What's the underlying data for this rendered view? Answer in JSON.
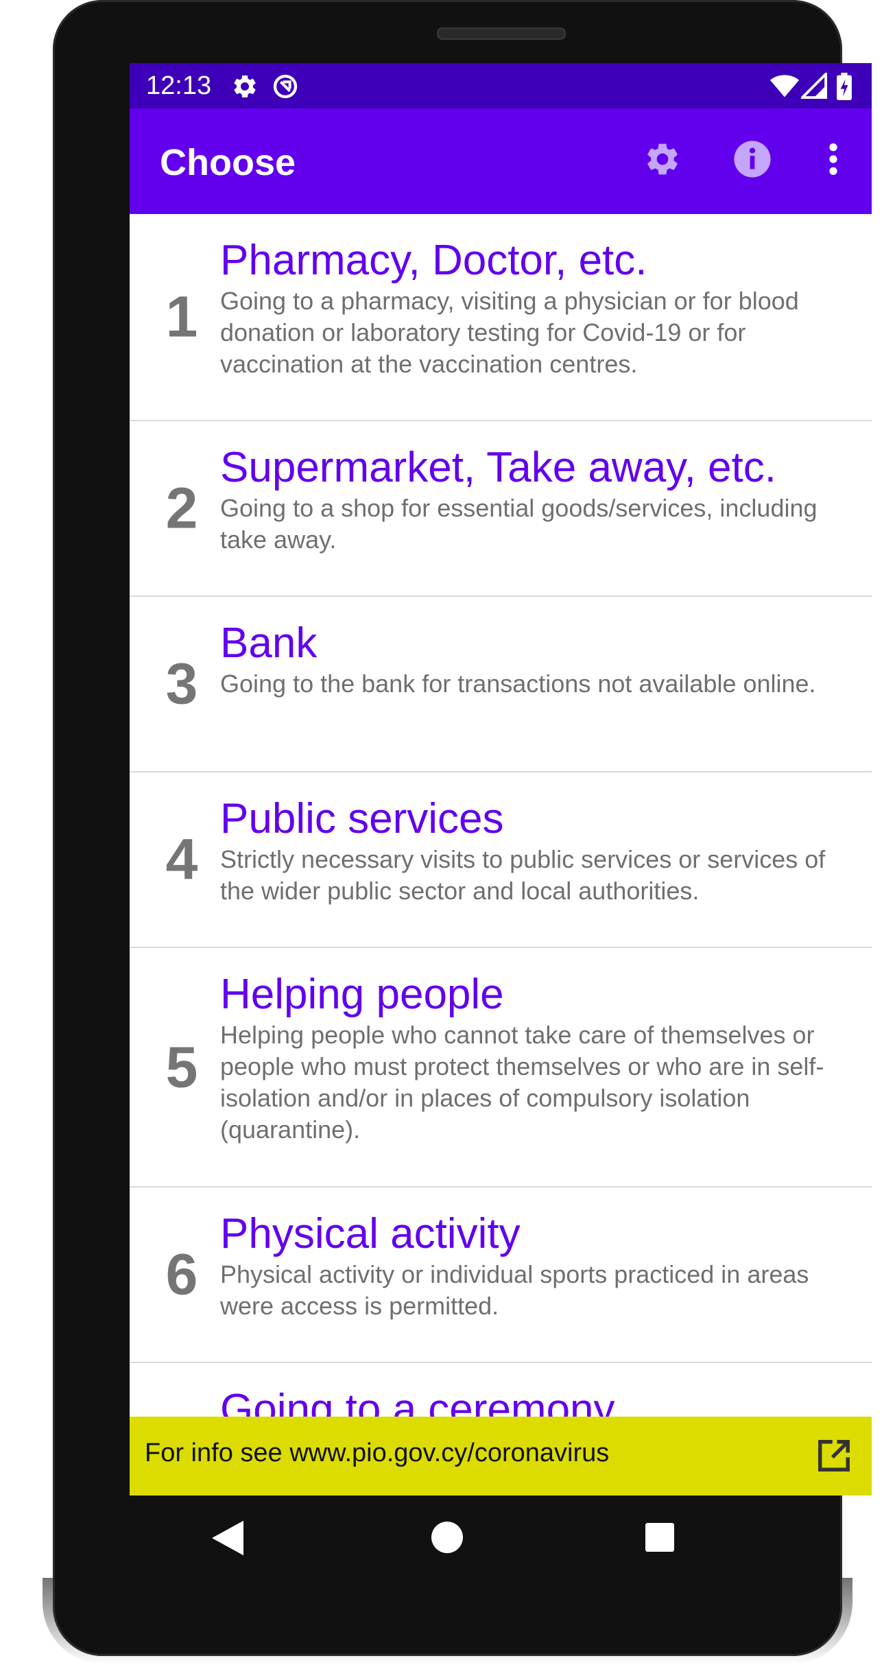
{
  "status_bar": {
    "time": "12:13",
    "icons": [
      "gear-icon",
      "accessibility-icon",
      "wifi-icon",
      "signal-icon",
      "battery-charging-icon"
    ]
  },
  "app_bar": {
    "title": "Choose",
    "actions": [
      "settings-icon",
      "info-icon",
      "more-vert-icon"
    ]
  },
  "items": [
    {
      "number": "1",
      "title": "Pharmacy, Doctor, etc.",
      "description": "Going to a pharmacy, visiting a physician or for blood donation or laboratory testing for Covid-19 or for vaccination at the vaccination centres."
    },
    {
      "number": "2",
      "title": "Supermarket, Take away, etc.",
      "description": "Going to a shop for essential goods/services, including take away."
    },
    {
      "number": "3",
      "title": "Bank",
      "description": "Going to the bank for transactions not available online."
    },
    {
      "number": "4",
      "title": "Public services",
      "description": "Strictly necessary visits to public services or services of the wider public sector and local authorities."
    },
    {
      "number": "5",
      "title": "Helping people",
      "description": "Helping people who cannot take care of themselves or people who must protect themselves or who are in self-isolation and/or in places of compulsory isolation (quarantine)."
    },
    {
      "number": "6",
      "title": "Physical activity",
      "description": "Physical activity or individual sports practiced in areas were access is permitted."
    },
    {
      "number": "",
      "title": "Going to a ceremony",
      "description": ""
    }
  ],
  "info_bar": {
    "text": "For info see www.pio.gov.cy/coronavirus",
    "icon": "open-in-new-icon"
  },
  "nav_bar": {
    "buttons": [
      "back-icon",
      "home-icon",
      "recents-icon"
    ]
  },
  "colors": {
    "status_bar": "#3d00b8",
    "app_bar": "#6200ee",
    "accent_title": "#6200ee",
    "info_bar": "#dcdc00",
    "icon_tint": "#c4a6ff"
  }
}
